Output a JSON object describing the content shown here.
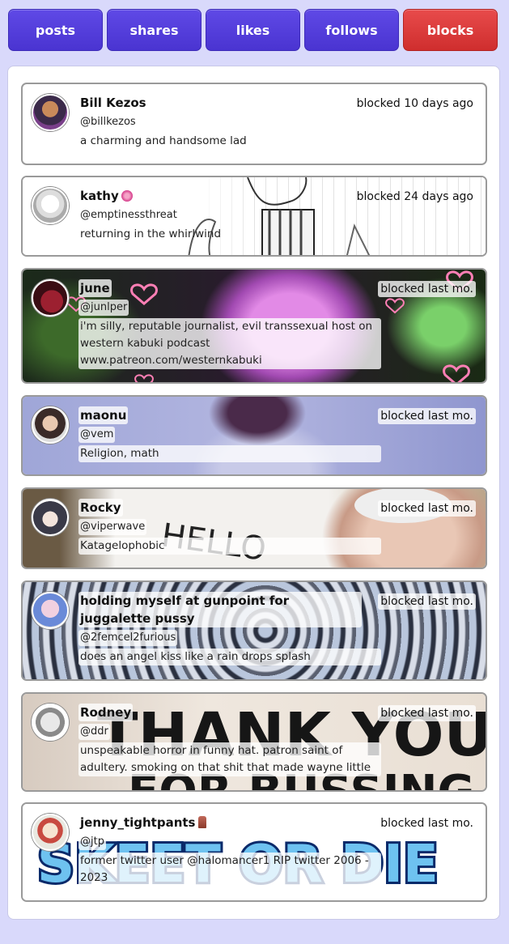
{
  "tabs": [
    {
      "label": "posts"
    },
    {
      "label": "shares"
    },
    {
      "label": "likes"
    },
    {
      "label": "follows"
    },
    {
      "label": "blocks"
    }
  ],
  "colors": {
    "tab": "#5440dc",
    "active_tab": "#dc3c3c",
    "page_bg": "#d9d9fb"
  },
  "blocks": [
    {
      "name": "Bill Kezos",
      "handle": "@billkezos",
      "bio": "a charming and handsome lad",
      "time": "blocked 10 days ago"
    },
    {
      "name": "kathy",
      "handle": "@emptinessthreat",
      "bio": "returning in the whirlwind",
      "time": "blocked 24 days ago"
    },
    {
      "name": "june",
      "handle": "@junlper",
      "bio": "i'm silly, reputable journalist, evil transsexual host on western kabuki podcast www.patreon.com/westernkabuki",
      "time": "blocked last mo."
    },
    {
      "name": "maonu",
      "handle": "@vem",
      "bio": "Religion, math",
      "time": "blocked last mo."
    },
    {
      "name": "Rocky",
      "handle": "@viperwave",
      "bio": "Katagelophobic",
      "time": "blocked last mo."
    },
    {
      "name": "holding myself at gunpoint for juggalette pussy",
      "handle": "@2femcel2furious",
      "bio": "does an angel kiss like a rain drops splash",
      "time": "blocked last mo."
    },
    {
      "name": "Rodney",
      "handle": "@ddr",
      "bio": "unspeakable horror in funny hat. patron saint of adultery. smoking on that shit that made wayne little",
      "time": "blocked last mo."
    },
    {
      "name": "jenny_tightpants",
      "handle": "@jtp",
      "bio": "former twitter user @halomancer1 RIP twitter 2006 - 2023",
      "time": "blocked last mo."
    }
  ],
  "banner_texts": {
    "rocky": "HELLO",
    "rodney": "THANK YOU",
    "rodney_2": "FOR BUSSING",
    "jenny": "SKEET OR DIE"
  }
}
